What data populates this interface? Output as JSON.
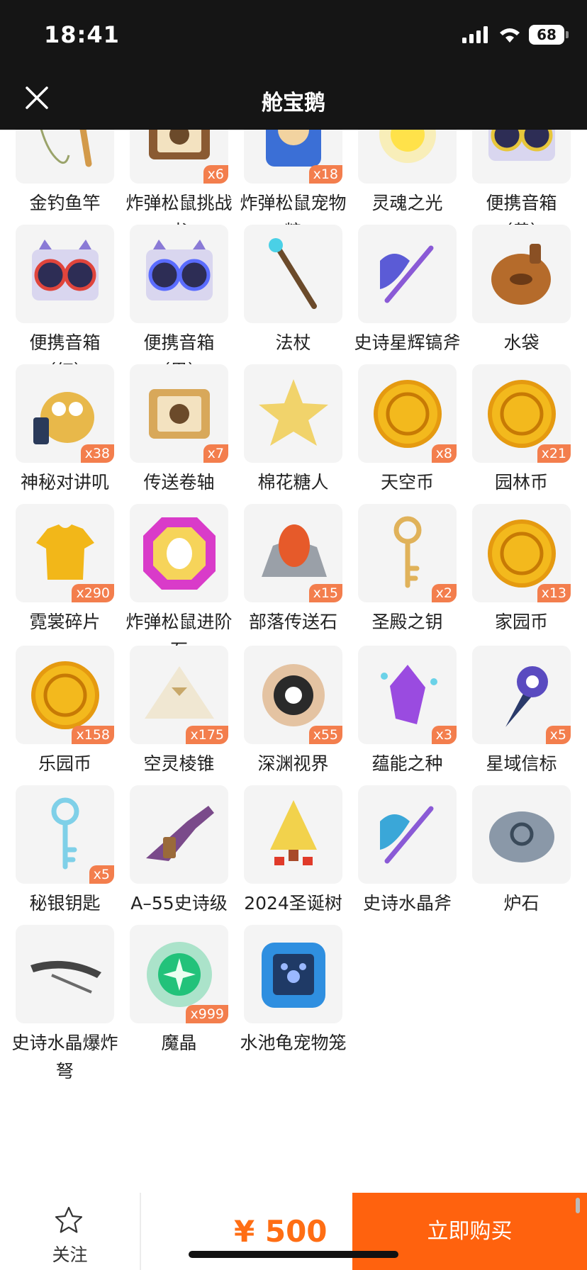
{
  "status": {
    "time": "18:41",
    "battery": "68"
  },
  "nav": {
    "title": "舱宝鹅"
  },
  "items": [
    {
      "label": "金钓鱼竿",
      "count": "",
      "icon": "rod",
      "color": "#d39a4a"
    },
    {
      "label": "炸弹松鼠挑战书",
      "count": "x6",
      "icon": "scroll",
      "color": "#8a5a32"
    },
    {
      "label": "炸弹松鼠宠物粮",
      "count": "x18",
      "icon": "bag",
      "color": "#3b6fd6"
    },
    {
      "label": "灵魂之光",
      "count": "",
      "icon": "glow",
      "color": "#ffe24a"
    },
    {
      "label": "便携音箱（黄）",
      "count": "",
      "icon": "speaker",
      "color": "#e7c63a"
    },
    {
      "label": "便携音箱（红）",
      "count": "",
      "icon": "speaker",
      "color": "#e0453c"
    },
    {
      "label": "便携音箱（黑）",
      "count": "",
      "icon": "speaker",
      "color": "#5a6cff"
    },
    {
      "label": "法杖",
      "count": "",
      "icon": "staff",
      "color": "#4ad0e6"
    },
    {
      "label": "史诗星辉镐斧",
      "count": "",
      "icon": "axe",
      "color": "#5b5bd6"
    },
    {
      "label": "水袋",
      "count": "",
      "icon": "flask",
      "color": "#b56b2b"
    },
    {
      "label": "神秘对讲叽",
      "count": "x38",
      "icon": "bird",
      "color": "#e8b84a"
    },
    {
      "label": "传送卷轴",
      "count": "x7",
      "icon": "scroll",
      "color": "#d8a85a"
    },
    {
      "label": "棉花糖人",
      "count": "",
      "icon": "star",
      "color": "#f1d36b"
    },
    {
      "label": "天空币",
      "count": "x8",
      "icon": "coin",
      "color": "#f3b91d"
    },
    {
      "label": "园林币",
      "count": "x21",
      "icon": "coin",
      "color": "#f3b91d"
    },
    {
      "label": "霓裳碎片",
      "count": "x290",
      "icon": "shirt",
      "color": "#f2b719"
    },
    {
      "label": "炸弹松鼠进阶石",
      "count": "",
      "icon": "gem",
      "color": "#d93bc9"
    },
    {
      "label": "部落传送石",
      "count": "x15",
      "icon": "rock",
      "color": "#e65a2a"
    },
    {
      "label": "圣殿之钥",
      "count": "x2",
      "icon": "key",
      "color": "#e0b25a"
    },
    {
      "label": "家园币",
      "count": "x13",
      "icon": "coin",
      "color": "#f3b91d"
    },
    {
      "label": "乐园币",
      "count": "x158",
      "icon": "coin",
      "color": "#f3b91d"
    },
    {
      "label": "空灵棱锥",
      "count": "x175",
      "icon": "pyramid",
      "color": "#f0e7d2"
    },
    {
      "label": "深渊视界",
      "count": "x55",
      "icon": "sun",
      "color": "#2a2a2a"
    },
    {
      "label": "蕴能之种",
      "count": "x3",
      "icon": "crystal",
      "color": "#9a4be0"
    },
    {
      "label": "星域信标",
      "count": "x5",
      "icon": "beacon",
      "color": "#5a4bc0"
    },
    {
      "label": "秘银钥匙",
      "count": "x5",
      "icon": "key",
      "color": "#7fd0e8"
    },
    {
      "label": "A–55史诗级",
      "count": "",
      "icon": "gun",
      "color": "#7a4a8a"
    },
    {
      "label": "2024圣诞树",
      "count": "",
      "icon": "tree",
      "color": "#f2d24c"
    },
    {
      "label": "史诗水晶斧",
      "count": "",
      "icon": "axe",
      "color": "#3aa7d8"
    },
    {
      "label": "炉石",
      "count": "",
      "icon": "stone",
      "color": "#8a98a8"
    },
    {
      "label": "史诗水晶爆炸弩",
      "count": "",
      "icon": "bow",
      "color": "#444444"
    },
    {
      "label": "魔晶",
      "count": "x999",
      "icon": "orb",
      "color": "#22c27a"
    },
    {
      "label": "水池龟宠物笼",
      "count": "",
      "icon": "cage",
      "color": "#2f8fe0"
    }
  ],
  "bottom": {
    "follow_label": "关注",
    "price": "¥ 500",
    "buy_label": "立即购买"
  },
  "theme": {
    "accent": "#ff620e",
    "badge": "#f37e4d",
    "topbar": "#151515"
  }
}
